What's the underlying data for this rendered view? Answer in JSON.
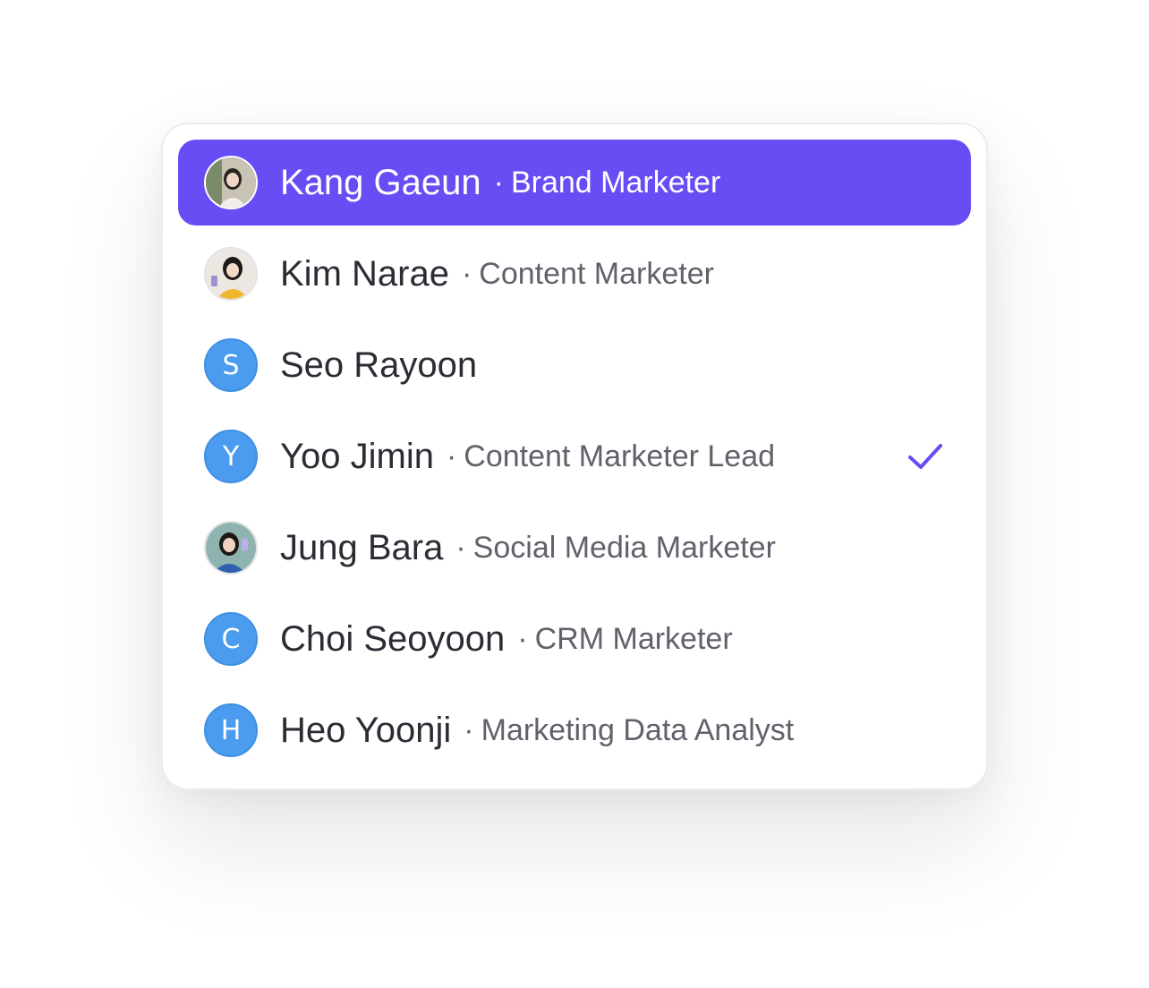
{
  "dropdown": {
    "options": [
      {
        "name": "Kang Gaeun",
        "role": "Brand Marketer",
        "avatar": "photo",
        "initial": "",
        "highlighted": true,
        "selected": false
      },
      {
        "name": "Kim Narae",
        "role": "Content Marketer",
        "avatar": "photo",
        "initial": "",
        "highlighted": false,
        "selected": false
      },
      {
        "name": "Seo Rayoon",
        "role": "",
        "avatar": "initial",
        "initial": "S",
        "highlighted": false,
        "selected": false
      },
      {
        "name": "Yoo Jimin",
        "role": "Content Marketer Lead",
        "avatar": "initial",
        "initial": "Y",
        "highlighted": false,
        "selected": true
      },
      {
        "name": "Jung Bara",
        "role": "Social Media Marketer",
        "avatar": "photo",
        "initial": "",
        "highlighted": false,
        "selected": false
      },
      {
        "name": "Choi Seoyoon",
        "role": "CRM Marketer",
        "avatar": "initial",
        "initial": "C",
        "highlighted": false,
        "selected": false
      },
      {
        "name": "Heo Yoonji",
        "role": "Marketing Data Analyst",
        "avatar": "initial",
        "initial": "H",
        "highlighted": false,
        "selected": false
      }
    ],
    "separator": "·",
    "check_icon": "check-icon"
  },
  "colors": {
    "accent": "#684cf4",
    "avatar_initial_bg": "#4b9cee",
    "check": "#684cf4"
  }
}
